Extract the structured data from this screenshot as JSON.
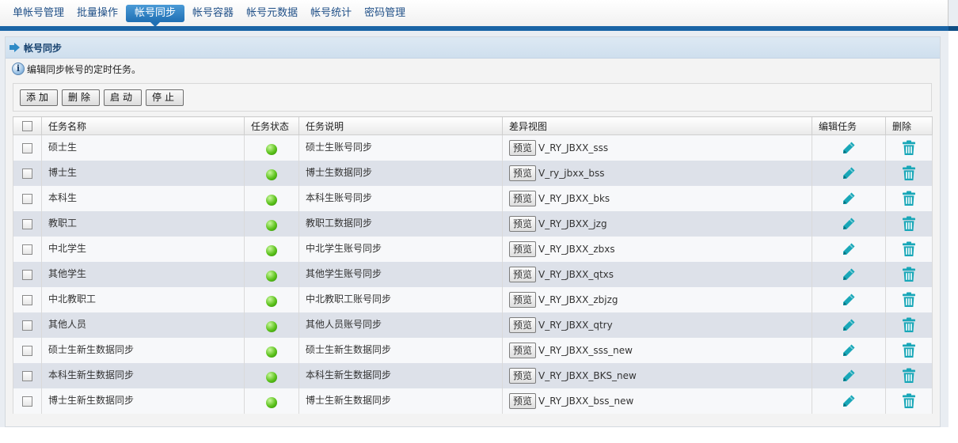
{
  "nav": {
    "tabs": [
      "单帐号管理",
      "批量操作",
      "帐号同步",
      "帐号容器",
      "帐号元数据",
      "帐号统计",
      "密码管理"
    ],
    "active_index": 2
  },
  "panel": {
    "title": "帐号同步",
    "info": "编辑同步帐号的定时任务。"
  },
  "toolbar": {
    "add": "添加",
    "delete": "删除",
    "start": "启动",
    "stop": "停止"
  },
  "table": {
    "headers": {
      "name": "任务名称",
      "status": "任务状态",
      "desc": "任务说明",
      "view": "差异视图",
      "edit": "编辑任务",
      "delete": "删除"
    },
    "preview_label": "预览",
    "status_color": "#5cc21c",
    "edit_icon": "pencil-icon",
    "delete_icon": "trash-icon",
    "icon_color": "#19a7b8",
    "rows": [
      {
        "name": "硕士生",
        "desc": "硕士生账号同步",
        "view": "V_RY_JBXX_sss"
      },
      {
        "name": "博士生",
        "desc": "博士生数据同步",
        "view": "V_ry_jbxx_bss"
      },
      {
        "name": "本科生",
        "desc": "本科生账号同步",
        "view": "V_RY_JBXX_bks"
      },
      {
        "name": "教职工",
        "desc": "教职工数据同步",
        "view": "V_RY_JBXX_jzg"
      },
      {
        "name": "中北学生",
        "desc": "中北学生账号同步",
        "view": "V_RY_JBXX_zbxs"
      },
      {
        "name": "其他学生",
        "desc": "其他学生账号同步",
        "view": "V_RY_JBXX_qtxs"
      },
      {
        "name": "中北教职工",
        "desc": "中北教职工账号同步",
        "view": "V_RY_JBXX_zbjzg"
      },
      {
        "name": "其他人员",
        "desc": "其他人员账号同步",
        "view": "V_RY_JBXX_qtry"
      },
      {
        "name": "硕士生新生数据同步",
        "desc": "硕士生新生数据同步",
        "view": "V_RY_JBXX_sss_new"
      },
      {
        "name": "本科生新生数据同步",
        "desc": "本科生新生数据同步",
        "view": "V_RY_JBXX_BKS_new"
      },
      {
        "name": "博士生新生数据同步",
        "desc": "博士生新生数据同步",
        "view": "V_RY_JBXX_bss_new"
      }
    ]
  }
}
